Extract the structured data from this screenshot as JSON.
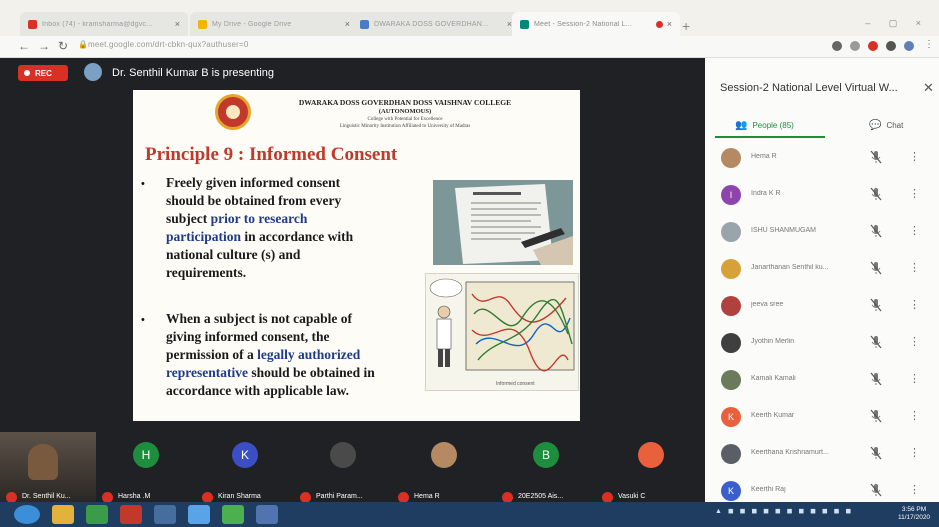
{
  "browser": {
    "tabs": [
      {
        "title": "Inbox (74) - kramsharma@dgvc...",
        "favicon_color": "#d93025",
        "active": false
      },
      {
        "title": "My Drive - Google Drive",
        "favicon_color": "#f4b400",
        "active": false
      },
      {
        "title": "DWARAKA DOSS GOVERDHAN...",
        "favicon_color": "#4a7cc4",
        "active": false
      },
      {
        "title": "Meet - Session-2 National L...",
        "favicon_color": "#00897b",
        "active": true
      }
    ],
    "url": "meet.google.com/drt-cbkn-qux?authuser=0"
  },
  "meet": {
    "rec_label": "REC",
    "presenting_text": "Dr. Senthil Kumar B is presenting",
    "slide": {
      "college_name": "DWARAKA DOSS GOVERDHAN DOSS VAISHNAV COLLEGE",
      "autonomous": "(AUTONOMOUS)",
      "tagline": "College with Potential for Excellence",
      "affiliation": "Linguistic Minority Institution Affiliated to University of Madras",
      "title": "Principle 9 : Informed Consent",
      "bullet1": {
        "line1": "Freely given informed consent",
        "line2": "should be  obtained from every",
        "line3_pre": "subject ",
        "line3_hl": "prior to research",
        "line4_hl": "participation",
        "line4_post": " in accordance with",
        "line5": "national  culture (s) and",
        "line6": "requirements."
      },
      "bullet2": {
        "line1": "When a subject  is not capable of",
        "line2": "giving informed consent,  the",
        "line3_pre": "permission of a ",
        "line3_hl": "legally authorized",
        "line4_hl": "representative",
        "line4_post": " should be obtained in",
        "line5": "accordance with applicable law."
      },
      "image_caption": "Informed consent"
    },
    "panel": {
      "title": "Session-2 National Level Virtual W...",
      "people_label": "People (85)",
      "chat_label": "Chat",
      "participants": [
        {
          "name": "Hema R",
          "initial": "",
          "color": "#b58a63"
        },
        {
          "name": "Indra K R",
          "initial": "I",
          "color": "#8e44ad"
        },
        {
          "name": "ISHU SHANMUGAM",
          "initial": "",
          "color": "#9aa5ab"
        },
        {
          "name": "Janarthanan Senthil ku...",
          "initial": "",
          "color": "#d7a13a"
        },
        {
          "name": "jeeva sree",
          "initial": "",
          "color": "#b0413e"
        },
        {
          "name": "Jyothin Merlin",
          "initial": "",
          "color": "#3f3f3f"
        },
        {
          "name": "Kamali Kamali",
          "initial": "",
          "color": "#6a7a5a"
        },
        {
          "name": "Keerth Kumar",
          "initial": "K",
          "color": "#e8603c"
        },
        {
          "name": "Keerthana Krishnamurt...",
          "initial": "",
          "color": "#5a5f66"
        },
        {
          "name": "Keerthi Raj",
          "initial": "K",
          "color": "#3a5fcd"
        }
      ]
    },
    "tiles": [
      {
        "name": "Dr. Senthil Ku...",
        "initial": "",
        "color": "#6b5d4a"
      },
      {
        "name": "Harsha .M",
        "initial": "H",
        "color": "#1e8e3e"
      },
      {
        "name": "Kiran Sharma",
        "initial": "K",
        "color": "#3c4ec4"
      },
      {
        "name": "Parthi Param...",
        "initial": "",
        "color": "#4a4a4a"
      },
      {
        "name": "Hema R",
        "initial": "",
        "color": "#b58a63"
      },
      {
        "name": "20E2505 Ais...",
        "initial": "B",
        "color": "#1e8e3e"
      },
      {
        "name": "Vasuki C",
        "initial": "",
        "color": "#e8603c"
      }
    ]
  },
  "taskbar": {
    "time": "3:56 PM",
    "date": "11/17/2020"
  }
}
